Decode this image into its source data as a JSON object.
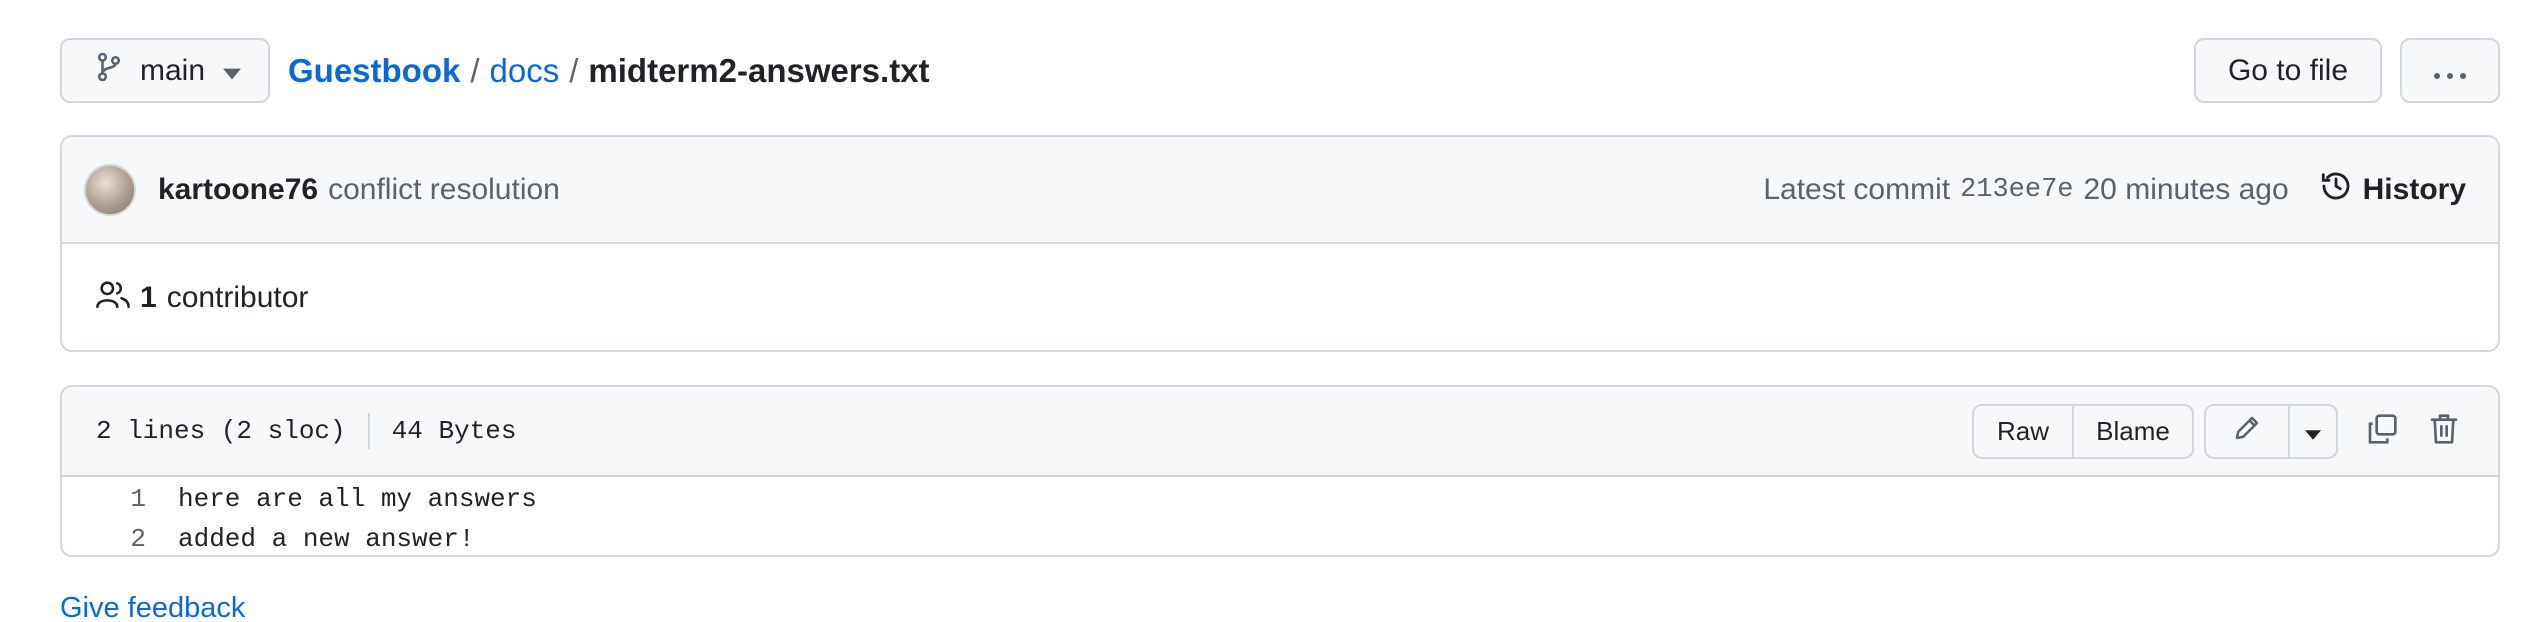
{
  "topbar": {
    "branch": "main",
    "repo": "Guestbook",
    "separator": "/",
    "folder": "docs",
    "file": "midterm2-answers.txt",
    "go_to_file": "Go to file",
    "more_label": "···"
  },
  "commit": {
    "author": "kartoone76",
    "message": "conflict resolution",
    "latest_label": "Latest commit",
    "sha": "213ee7e",
    "time": "20 minutes ago",
    "history": "History"
  },
  "contributors": {
    "count": "1",
    "label": "contributor"
  },
  "file": {
    "lines_info": "2 lines (2 sloc)",
    "size": "44 Bytes",
    "raw": "Raw",
    "blame": "Blame",
    "lines": [
      {
        "num": "1",
        "text": "here are all my answers"
      },
      {
        "num": "2",
        "text": "added a new answer!"
      }
    ]
  },
  "footer": {
    "feedback": "Give feedback"
  },
  "colors": {
    "link": "#0969da",
    "text": "#1f2328",
    "muted": "#59636e",
    "border": "#d0d7de",
    "subtle_bg": "#f6f8fa"
  }
}
